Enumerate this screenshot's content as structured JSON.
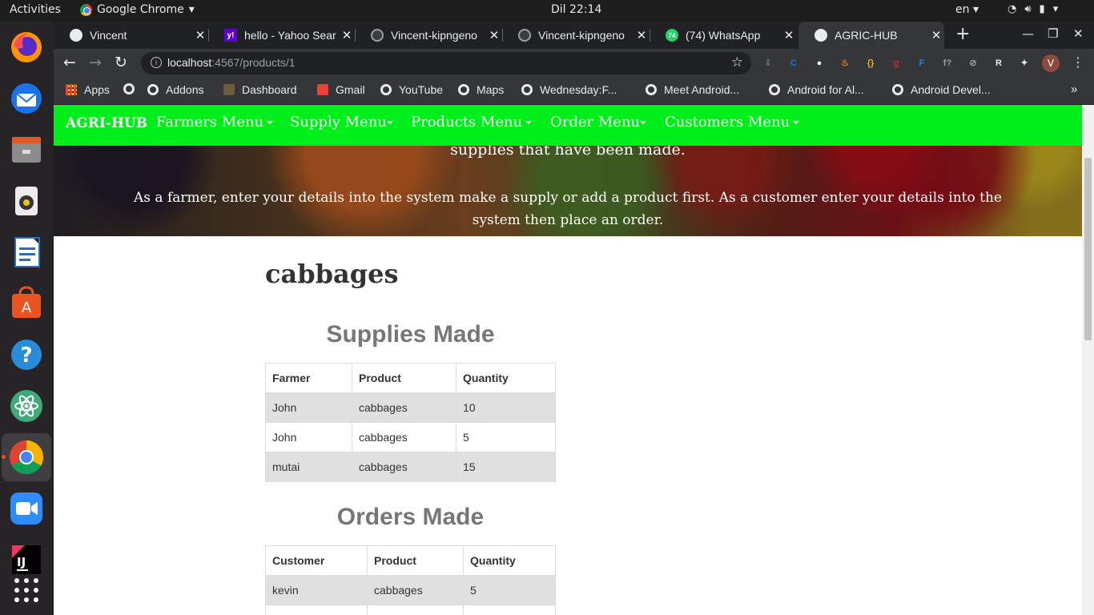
{
  "system": {
    "activities": "Activities",
    "app_name": "Google Chrome",
    "clock": "Dil 22:14",
    "language": "en"
  },
  "dock": {
    "items": [
      "firefox-icon",
      "thunderbird-icon",
      "files-icon",
      "rhythmbox-icon",
      "writer-icon",
      "software-center-icon",
      "help-icon",
      "atom-icon",
      "chrome-icon",
      "zoom-icon",
      "intellij-icon",
      "show-apps-icon"
    ],
    "intellij_label": "IJ"
  },
  "browser": {
    "tabs": [
      {
        "title": "Vincent",
        "icon": "globe-icon"
      },
      {
        "title": "hello - Yahoo Sear",
        "icon": "yahoo-icon",
        "icon_text": "y!"
      },
      {
        "title": "Vincent-kipngeno",
        "icon": "github-icon"
      },
      {
        "title": "Vincent-kipngeno",
        "icon": "github-icon"
      },
      {
        "title": "(74) WhatsApp",
        "icon": "whatsapp-icon",
        "icon_text": "74"
      },
      {
        "title": "AGRIC-HUB",
        "icon": "globe-icon",
        "active": true
      }
    ],
    "url": {
      "host": "localhost",
      "path": ":4567/products/1"
    },
    "profile_initial": "V",
    "extensions": [
      {
        "name": "download-icon",
        "label": "⬇",
        "color": "#5f6368"
      },
      {
        "name": "c-extension-icon",
        "label": "C",
        "color": "#1a73e8"
      },
      {
        "name": "circle-extension-icon",
        "label": "●",
        "color": "#e8eaed"
      },
      {
        "name": "fire-extension-icon",
        "label": "♨",
        "color": "#f57c00"
      },
      {
        "name": "braces-extension-icon",
        "label": "{}",
        "color": "#f9a825"
      },
      {
        "name": "g-extension-icon",
        "label": "g",
        "color": "#c62828"
      },
      {
        "name": "f-extension-icon",
        "label": "F",
        "color": "#1e88e5"
      },
      {
        "name": "function-extension-icon",
        "label": "f?",
        "color": "#9aa0a6"
      },
      {
        "name": "grey-extension-icon",
        "label": "⊘",
        "color": "#9aa0a6"
      },
      {
        "name": "r-extension-icon",
        "label": "R",
        "color": "#e8eaed"
      },
      {
        "name": "puzzle-icon",
        "label": "✦",
        "color": "#e8eaed"
      }
    ],
    "bookmarks": [
      {
        "label": "Apps",
        "icon": "grid"
      },
      {
        "label": "",
        "icon": "globe"
      },
      {
        "label": "Addons",
        "icon": "globe"
      },
      {
        "label": "Dashboard",
        "icon": "palm"
      },
      {
        "label": "Gmail",
        "icon": "gmail"
      },
      {
        "label": "YouTube",
        "icon": "globe"
      },
      {
        "label": "Maps",
        "icon": "globe"
      },
      {
        "label": "Wednesday:F...",
        "icon": "globe"
      },
      {
        "label": "Meet Android...",
        "icon": "globe"
      },
      {
        "label": "Android for Al...",
        "icon": "globe"
      },
      {
        "label": "Android Devel...",
        "icon": "globe"
      }
    ],
    "bookmarks_more": "»"
  },
  "page": {
    "brand": "AGRI-HUB",
    "menus": [
      "Farmers Menu",
      "Supply Menu",
      "Products Menu",
      "Order Menu",
      "Customers Menu"
    ],
    "hero_line1": "supplies that have been made.",
    "hero_line2": "As a farmer, enter your details into the system make a supply or add a product first. As a customer enter your details into the system then place an order.",
    "product_name": "cabbages",
    "supplies": {
      "title": "Supplies Made",
      "headers": [
        "Farmer",
        "Product",
        "Quantity"
      ],
      "rows": [
        [
          "John",
          "cabbages",
          "10"
        ],
        [
          "John",
          "cabbages",
          "5"
        ],
        [
          "mutai",
          "cabbages",
          "15"
        ]
      ]
    },
    "orders": {
      "title": "Orders Made",
      "headers": [
        "Customer",
        "Product",
        "Quantity"
      ],
      "rows": [
        [
          "kevin",
          "cabbages",
          "5"
        ],
        [
          "",
          "",
          ""
        ]
      ]
    }
  }
}
